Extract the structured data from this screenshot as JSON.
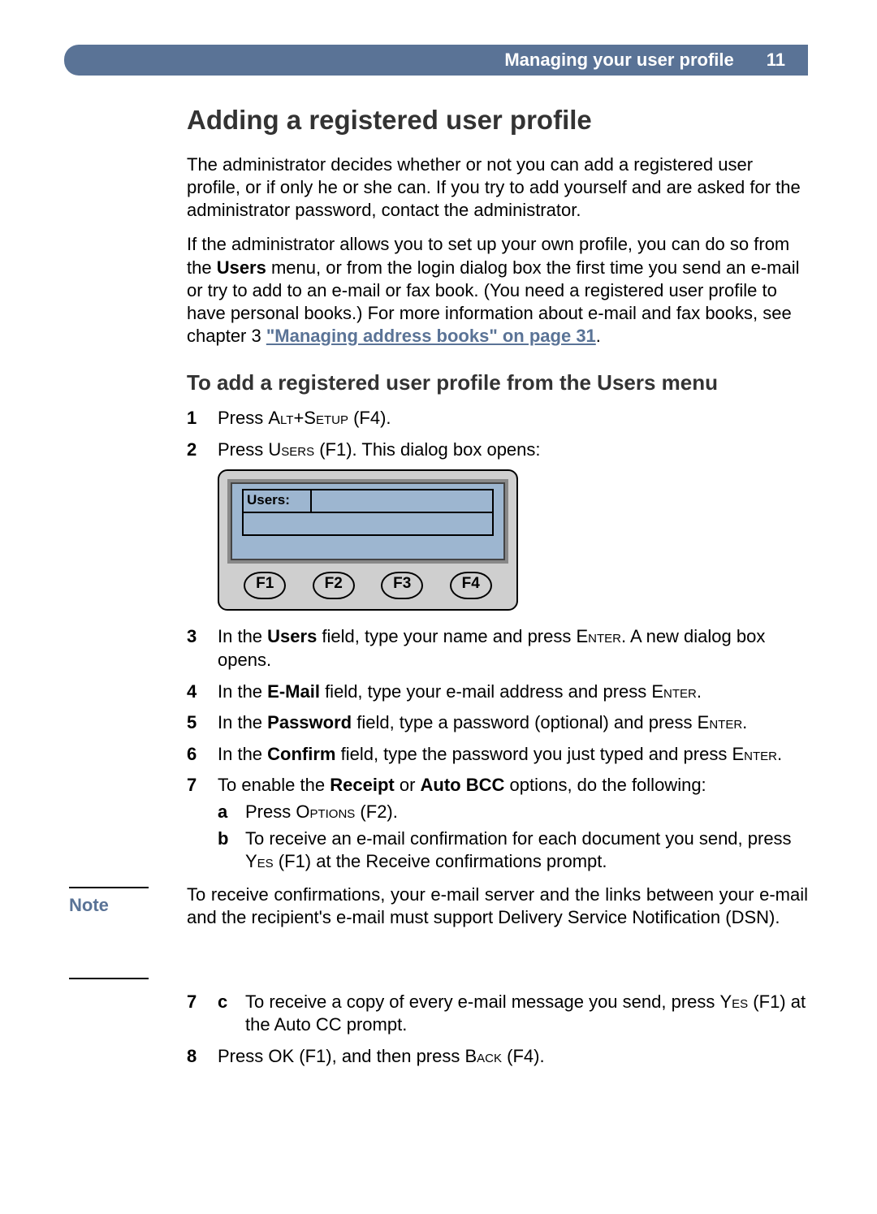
{
  "header": {
    "title": "Managing your user profile",
    "page": "11"
  },
  "h1": "Adding a registered user profile",
  "para1": "The administrator decides whether or not you can add a registered user profile, or if only he or she can. If you try to add yourself and are asked for the administrator password, contact the administrator.",
  "para2a": "If the administrator allows you to set up your own profile, you can do so from the ",
  "para2_bold": "Users",
  "para2b": " menu, or from the login dialog box the first time you send an e-mail or try to add to an e-mail or fax book. (You need a registered user profile to have personal books.) For more information about e-mail and fax books, see chapter 3 ",
  "para2_link": "\"Managing address books\" on page 31",
  "para2c": ".",
  "h2": "To add a registered user profile from the Users menu",
  "steps": {
    "s1": {
      "pre": "Press ",
      "sc1": "Alt",
      "mid1": "+",
      "sc2": "Setup",
      "post": " (F4)."
    },
    "s2": {
      "pre": "Press ",
      "sc1": "Users",
      "post": " (F1). This dialog box opens:"
    },
    "s3": {
      "pre": "In the ",
      "b": "Users",
      "mid": " field, type your name and press ",
      "sc": "Enter",
      "post": ". A new dialog box opens."
    },
    "s4": {
      "pre": "In the ",
      "b": "E-Mail",
      "mid": " field, type your e-mail address and press ",
      "sc": "Enter",
      "post": "."
    },
    "s5": {
      "pre": "In the ",
      "b": "Password",
      "mid": " field, type a password (optional) and press ",
      "sc": "Enter",
      "post": "."
    },
    "s6": {
      "pre": "In the ",
      "b": "Confirm",
      "mid": " field, type the password you just typed and press ",
      "sc": "Enter",
      "post": "."
    },
    "s7": {
      "pre": "To enable the ",
      "b1": "Receipt",
      "mid1": " or ",
      "b2": "Auto BCC",
      "post": " options, do the following:"
    },
    "s7a": {
      "pre": "Press ",
      "sc": "Options",
      "post": " (F2)."
    },
    "s7b": {
      "pre": "To receive an e-mail confirmation for each document you send, press ",
      "sc": "Yes",
      "post": " (F1) at the Receive confirmations prompt."
    },
    "s7c": {
      "pre": "To receive a copy of every e-mail message you send, press ",
      "sc": "Yes",
      "post": " (F1) at the Auto CC prompt."
    },
    "s8": {
      "pre": "Press ",
      "sc1": "OK",
      "mid": " (F1), and then press ",
      "sc2": "Back",
      "post": " (F4)."
    }
  },
  "note": {
    "label": "Note",
    "body": "To receive confirmations, your e-mail server and the links between your e-mail and the recipient's e-mail must support Delivery Service Notification (DSN)."
  },
  "device": {
    "screen_label": "Users:",
    "f1": "F1",
    "f2": "F2",
    "f3": "F3",
    "f4": "F4"
  }
}
